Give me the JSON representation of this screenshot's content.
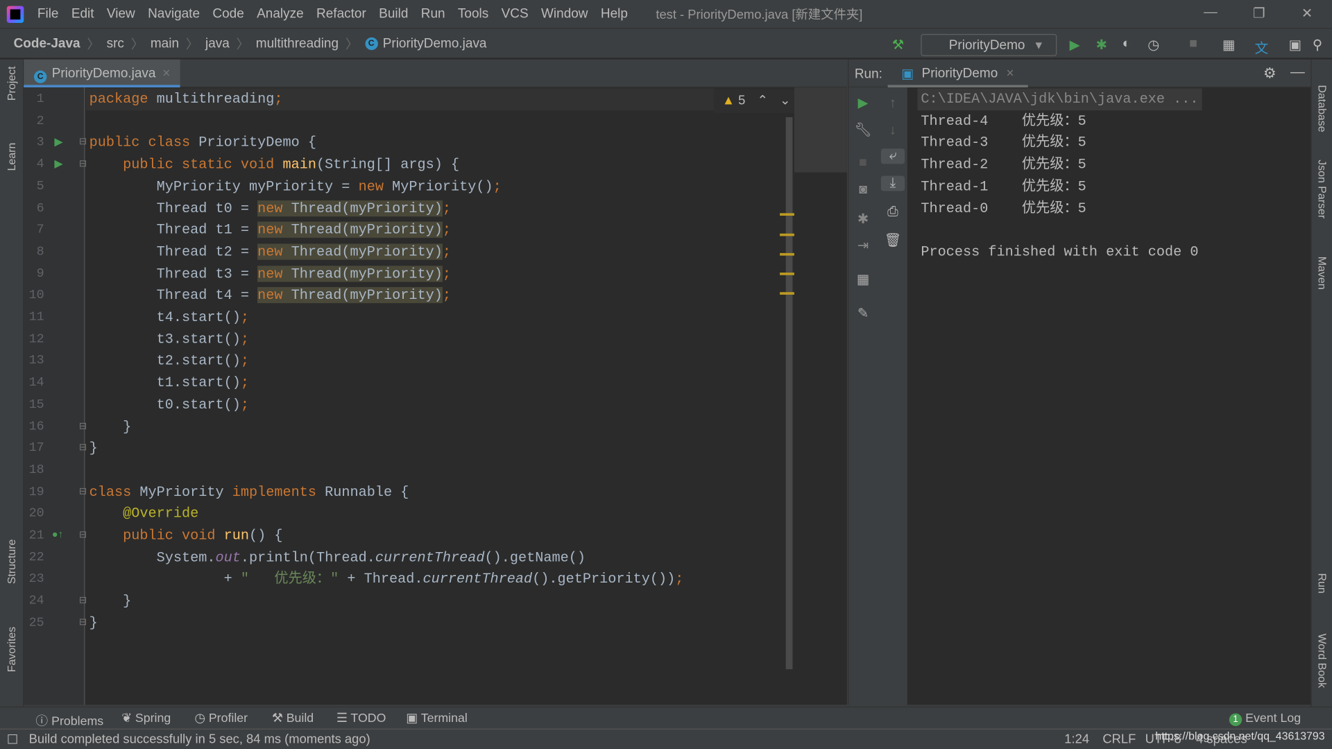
{
  "menu": [
    "File",
    "Edit",
    "View",
    "Navigate",
    "Code",
    "Analyze",
    "Refactor",
    "Build",
    "Run",
    "Tools",
    "VCS",
    "Window",
    "Help"
  ],
  "window_title": "test - PriorityDemo.java [新建文件夹]",
  "breadcrumb": [
    "Code-Java",
    "src",
    "main",
    "java",
    "multithreading",
    "PriorityDemo.java"
  ],
  "run_config": "PriorityDemo",
  "left_tools": [
    "Project",
    "Learn",
    "Structure",
    "Favorites"
  ],
  "right_tools": [
    "Database",
    "Json Parser",
    "Maven",
    "Run",
    "Word Book"
  ],
  "editor_tab": "PriorityDemo.java",
  "warnings_count": "5",
  "code": [
    [
      [
        "package ",
        "k"
      ],
      [
        "multithreading",
        ""
      ],
      [
        ";",
        "k"
      ]
    ],
    [],
    [
      [
        "public class ",
        "k"
      ],
      [
        "PriorityDemo {",
        ""
      ]
    ],
    [
      [
        "    public static void ",
        "k"
      ],
      [
        "main",
        "m"
      ],
      [
        "(String[] args) {",
        ""
      ]
    ],
    [
      [
        "        MyPriority myPriority = ",
        ""
      ],
      [
        "new ",
        "k"
      ],
      [
        "MyPriority()",
        ""
      ],
      [
        ";",
        "k"
      ]
    ],
    [
      [
        "        Thread t0 = ",
        ""
      ],
      [
        "new ",
        "k hl"
      ],
      [
        "Thread(myPriority)",
        "hl"
      ],
      [
        ";",
        "k"
      ]
    ],
    [
      [
        "        Thread t1 = ",
        ""
      ],
      [
        "new ",
        "k hl"
      ],
      [
        "Thread(myPriority)",
        "hl"
      ],
      [
        ";",
        "k"
      ]
    ],
    [
      [
        "        Thread t2 = ",
        ""
      ],
      [
        "new ",
        "k hl"
      ],
      [
        "Thread(myPriority)",
        "hl"
      ],
      [
        ";",
        "k"
      ]
    ],
    [
      [
        "        Thread t3 = ",
        ""
      ],
      [
        "new ",
        "k hl"
      ],
      [
        "Thread(myPriority)",
        "hl"
      ],
      [
        ";",
        "k"
      ]
    ],
    [
      [
        "        Thread t4 = ",
        ""
      ],
      [
        "new ",
        "k hl"
      ],
      [
        "Thread(myPriority)",
        "hl"
      ],
      [
        ";",
        "k"
      ]
    ],
    [
      [
        "        t4.start()",
        ""
      ],
      [
        ";",
        "k"
      ]
    ],
    [
      [
        "        t3.start()",
        ""
      ],
      [
        ";",
        "k"
      ]
    ],
    [
      [
        "        t2.start()",
        ""
      ],
      [
        ";",
        "k"
      ]
    ],
    [
      [
        "        t1.start()",
        ""
      ],
      [
        ";",
        "k"
      ]
    ],
    [
      [
        "        t0.start()",
        ""
      ],
      [
        ";",
        "k"
      ]
    ],
    [
      [
        "    }",
        ""
      ]
    ],
    [
      [
        "}",
        ""
      ]
    ],
    [],
    [
      [
        "class ",
        "k"
      ],
      [
        "MyPriority ",
        ""
      ],
      [
        "implements ",
        "k"
      ],
      [
        "Runnable {",
        ""
      ]
    ],
    [
      [
        "    ",
        ""
      ],
      [
        "@Override",
        "a"
      ]
    ],
    [
      [
        "    public void ",
        "k"
      ],
      [
        "run",
        "m"
      ],
      [
        "() {",
        ""
      ]
    ],
    [
      [
        "        System.",
        ""
      ],
      [
        "out",
        "f"
      ],
      [
        ".println(Thread.",
        ""
      ],
      [
        "currentThread",
        "i"
      ],
      [
        "().getName()",
        ""
      ]
    ],
    [
      [
        "                + ",
        ""
      ],
      [
        "\"   优先级：\"",
        "s"
      ],
      [
        " + Thread.",
        ""
      ],
      [
        "currentThread",
        "i"
      ],
      [
        "().getPriority())",
        ""
      ],
      [
        ";",
        "k"
      ]
    ],
    [
      [
        "    }",
        ""
      ]
    ],
    [
      [
        "}",
        ""
      ]
    ]
  ],
  "run": {
    "label": "Run:",
    "tab": "PriorityDemo",
    "output": [
      "C:\\IDEA\\JAVA\\jdk\\bin\\java.exe ...",
      "Thread-4    优先级：5",
      "Thread-3    优先级：5",
      "Thread-2    优先级：5",
      "Thread-1    优先级：5",
      "Thread-0    优先级：5",
      "",
      "Process finished with exit code 0"
    ]
  },
  "bottom_tools": [
    "Problems",
    "Spring",
    "Profiler",
    "Build",
    "TODO",
    "Terminal"
  ],
  "event_log": {
    "label": "Event Log",
    "count": "1"
  },
  "status": {
    "message": "Build completed successfully in 5 sec, 84 ms (moments ago)",
    "position": "1:24",
    "line_sep": "CRLF",
    "encoding": "UTF-8",
    "indent": "4 spaces",
    "watermark": "https://blog.csdn.net/qq_43613793"
  }
}
